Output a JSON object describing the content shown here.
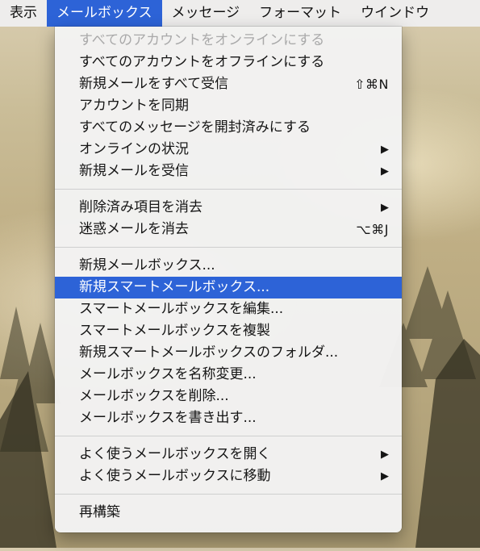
{
  "menubar": {
    "items": [
      "表示",
      "メールボックス",
      "メッセージ",
      "フォーマット",
      "ウインドウ"
    ]
  },
  "menu": {
    "groups": [
      [
        {
          "label": "すべてのアカウントをオンラインにする",
          "disabled": true
        },
        {
          "label": "すべてのアカウントをオフラインにする"
        },
        {
          "label": "新規メールをすべて受信",
          "shortcut": "⇧⌘N"
        },
        {
          "label": "アカウントを同期"
        },
        {
          "label": "すべてのメッセージを開封済みにする"
        },
        {
          "label": "オンラインの状況",
          "submenu": "▶"
        },
        {
          "label": "新規メールを受信",
          "submenu": "▶"
        }
      ],
      [
        {
          "label": "削除済み項目を消去",
          "submenu": "▶"
        },
        {
          "label": "迷惑メールを消去",
          "shortcut": "⌥⌘J"
        }
      ],
      [
        {
          "label": "新規メールボックス..."
        },
        {
          "label": "新規スマートメールボックス...",
          "highlighted": true
        },
        {
          "label": "スマートメールボックスを編集..."
        },
        {
          "label": "スマートメールボックスを複製"
        },
        {
          "label": "新規スマートメールボックスのフォルダ..."
        },
        {
          "label": "メールボックスを名称変更..."
        },
        {
          "label": "メールボックスを削除..."
        },
        {
          "label": "メールボックスを書き出す..."
        }
      ],
      [
        {
          "label": "よく使うメールボックスを開く",
          "submenu": "▶"
        },
        {
          "label": "よく使うメールボックスに移動",
          "submenu": "▶"
        }
      ],
      [
        {
          "label": "再構築"
        }
      ]
    ]
  },
  "colors": {
    "highlight": "#2d63d7",
    "disabled_text": "#a9a9a9"
  }
}
